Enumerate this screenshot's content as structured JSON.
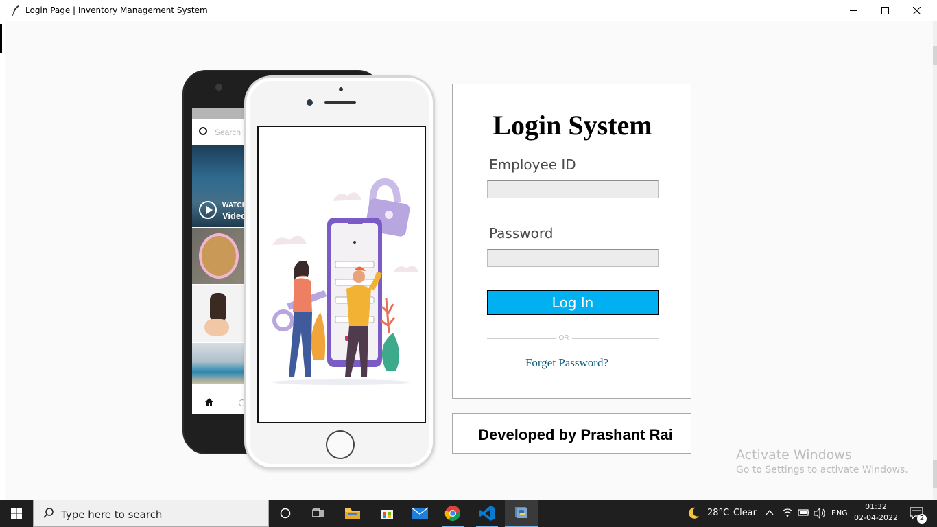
{
  "window": {
    "title": "Login Page | Inventory Management System",
    "minimize": "—",
    "maximize": "☐",
    "close": "✕"
  },
  "illustration": {
    "search_placeholder": "Search",
    "watch_label": "WATCH",
    "video_label": "Video"
  },
  "login": {
    "heading": "Login System",
    "employee_label": "Employee ID",
    "employee_value": "",
    "password_label": "Password",
    "password_value": "",
    "login_button": "Log In",
    "or_text": "OR",
    "forget_link": "Forget Password?"
  },
  "footer": {
    "developer": "Developed by Prashant Rai"
  },
  "watermark": {
    "title": "Activate Windows",
    "subtitle": "Go to Settings to activate Windows."
  },
  "taskbar": {
    "search_placeholder": "Type here to search",
    "weather_temp": "28°C",
    "weather_text": "Clear",
    "language": "ENG",
    "time": "01:32",
    "date": "02-04-2022",
    "notification_count": "2"
  },
  "colors": {
    "login_button": "#00b0f0",
    "forget_link": "#0a5a7c",
    "taskbar": "#1f1f1f"
  }
}
